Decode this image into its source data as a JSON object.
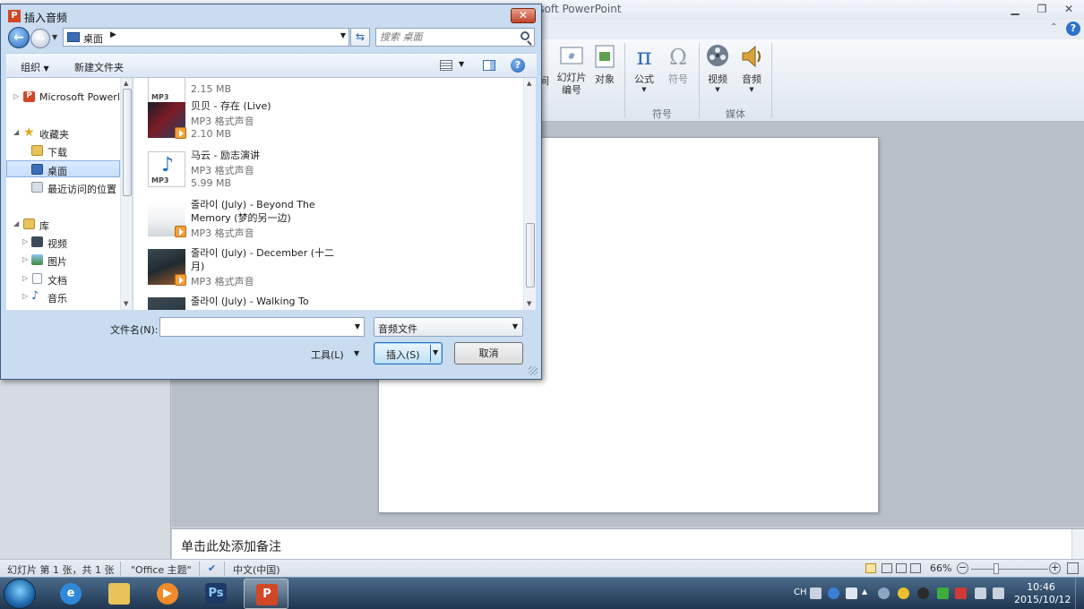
{
  "ppt": {
    "title": "osoft PowerPoint",
    "ribbon": {
      "btn_partial": "间",
      "btn_slide_number": "幻灯片\n编号",
      "btn_object": "对象",
      "btn_equation": "公式",
      "btn_symbol": "符号",
      "group_symbols": "符号",
      "btn_video": "视频",
      "btn_audio": "音频",
      "group_media": "媒体"
    },
    "notes_placeholder": "单击此处添加备注",
    "status": {
      "slide_info": "幻灯片 第 1 张，共 1 张",
      "theme": "\"Office 主题\"",
      "language": "中文(中国)",
      "zoom": "66%",
      "zoom_level": 0.32
    }
  },
  "dialog": {
    "title": "插入音频",
    "address": "桌面",
    "search_placeholder": "搜索 桌面",
    "organize": "组织",
    "new_folder": "新建文件夹",
    "nav": [
      {
        "label": "Microsoft Powerl",
        "icon": "powerpoint-icon",
        "selected": false
      },
      {
        "label": "收藏夹",
        "icon": "star-icon",
        "selected": false
      },
      {
        "label": "下载",
        "icon": "download-folder-icon",
        "selected": false
      },
      {
        "label": "桌面",
        "icon": "desktop-icon",
        "selected": true
      },
      {
        "label": "最近访问的位置",
        "icon": "recent-places-icon",
        "selected": false
      },
      {
        "label": "库",
        "icon": "library-icon",
        "selected": false
      },
      {
        "label": "视频",
        "icon": "video-library-icon",
        "selected": false
      },
      {
        "label": "图片",
        "icon": "pictures-library-icon",
        "selected": false
      },
      {
        "label": "文档",
        "icon": "documents-library-icon",
        "selected": false
      },
      {
        "label": "音乐",
        "icon": "music-library-icon",
        "selected": false
      }
    ],
    "files": [
      {
        "name": "",
        "type": "",
        "size": "2.15 MB"
      },
      {
        "name": "贝贝 - 存在 (Live)",
        "type": "MP3 格式声音",
        "size": "2.10 MB"
      },
      {
        "name": "马云 - 励志演讲",
        "type": "MP3 格式声音",
        "size": "5.99 MB"
      },
      {
        "name": "줄라이 (July) - Beyond The Memory (梦的另一边)",
        "type": "MP3 格式声音",
        "size": ""
      },
      {
        "name": "줄라이 (July) - December (十二月)",
        "type": "MP3 格式声音",
        "size": ""
      },
      {
        "name": "줄라이 (July) - Walking To",
        "type": "",
        "size": ""
      }
    ],
    "mp3_label": "MP3",
    "filename_label": "文件名(N):",
    "filename_value": "",
    "filetype": "音频文件",
    "tools": "工具(L)",
    "insert": "插入(S)",
    "cancel": "取消"
  },
  "taskbar": {
    "lang": "CH",
    "time": "10:46",
    "date": "2015/10/12"
  }
}
